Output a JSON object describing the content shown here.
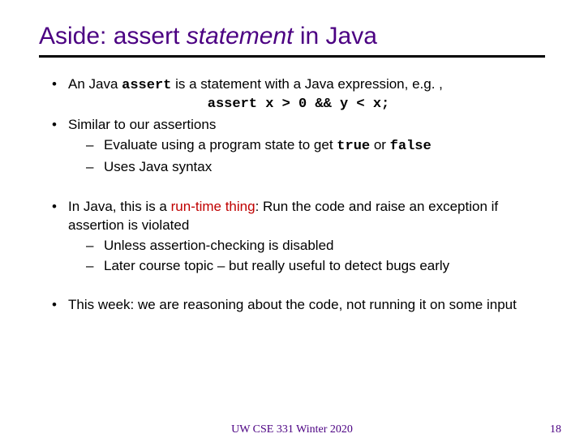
{
  "title": {
    "pre": "Aside: assert ",
    "italic": "statement",
    "post": " in Java"
  },
  "b1": {
    "pre": "An Java ",
    "code": "assert",
    "post": " is a statement with a Java expression, e.g. ,",
    "example": "assert x > 0 && y < x;"
  },
  "b2": {
    "text": "Similar to our assertions",
    "s1_pre": "Evaluate using a program state to get ",
    "s1_true": "true",
    "s1_mid": " or ",
    "s1_false": "false",
    "s2": "Uses Java syntax"
  },
  "b3": {
    "pre": "In Java, this is a ",
    "red": "run-time thing",
    "post": ": Run the code and raise an exception if assertion is violated",
    "s1": "Unless assertion-checking is disabled",
    "s2": "Later course topic – but really useful to detect bugs early"
  },
  "b4": {
    "text": "This week: we are reasoning about the code, not running it on some input"
  },
  "footer": {
    "course": "UW CSE 331 Winter 2020",
    "page": "18"
  }
}
